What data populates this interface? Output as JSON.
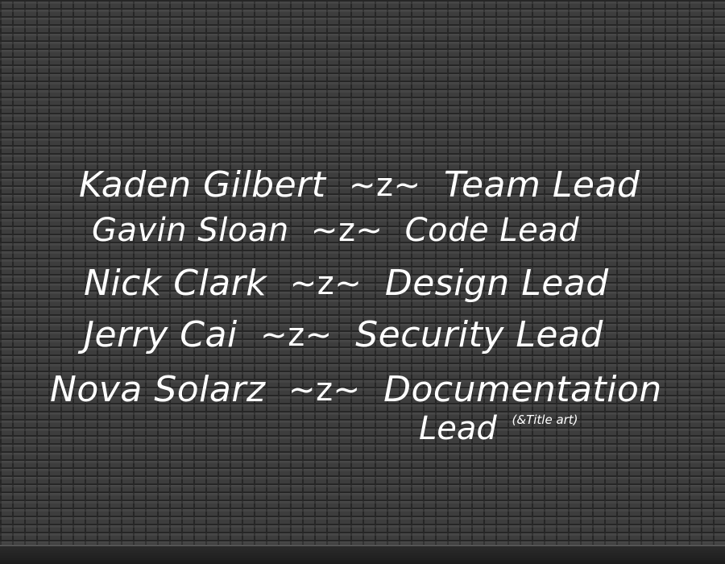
{
  "credits": [
    {
      "name": "Kaden Gilbert",
      "arrow": "~z~",
      "role": "Team Lead"
    },
    {
      "name": "Gavin Sloan",
      "arrow": "~z~",
      "role": "Code Lead"
    },
    {
      "name": "Nick Clark",
      "arrow": "~z~",
      "role": "Design Lead"
    },
    {
      "name": "Jerry Cai",
      "arrow": "~z~",
      "role": "Security Lead"
    },
    {
      "name": "Nova Solarz",
      "arrow": "~z~",
      "role": "Documentation",
      "role_continued": "Lead",
      "role_note": "(&Title art)"
    }
  ],
  "colors": {
    "text": "#ffffff",
    "brick": "#3d3d3d",
    "mortar": "#262626"
  }
}
